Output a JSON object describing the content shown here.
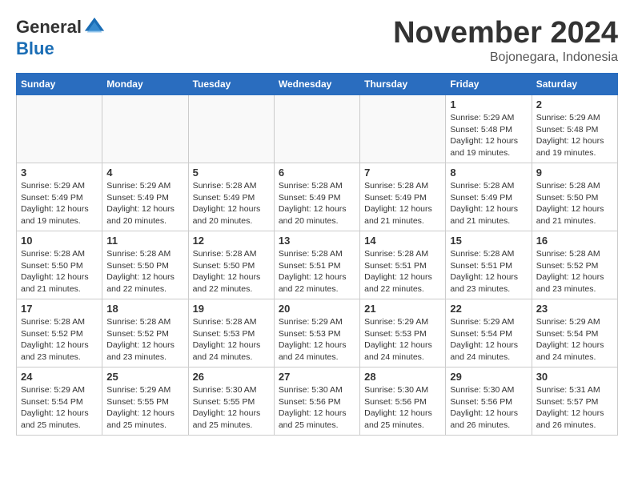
{
  "header": {
    "logo_general": "General",
    "logo_blue": "Blue",
    "month_title": "November 2024",
    "location": "Bojonegara, Indonesia"
  },
  "weekdays": [
    "Sunday",
    "Monday",
    "Tuesday",
    "Wednesday",
    "Thursday",
    "Friday",
    "Saturday"
  ],
  "weeks": [
    [
      {
        "day": "",
        "info": ""
      },
      {
        "day": "",
        "info": ""
      },
      {
        "day": "",
        "info": ""
      },
      {
        "day": "",
        "info": ""
      },
      {
        "day": "",
        "info": ""
      },
      {
        "day": "1",
        "info": "Sunrise: 5:29 AM\nSunset: 5:48 PM\nDaylight: 12 hours\nand 19 minutes."
      },
      {
        "day": "2",
        "info": "Sunrise: 5:29 AM\nSunset: 5:48 PM\nDaylight: 12 hours\nand 19 minutes."
      }
    ],
    [
      {
        "day": "3",
        "info": "Sunrise: 5:29 AM\nSunset: 5:49 PM\nDaylight: 12 hours\nand 19 minutes."
      },
      {
        "day": "4",
        "info": "Sunrise: 5:29 AM\nSunset: 5:49 PM\nDaylight: 12 hours\nand 20 minutes."
      },
      {
        "day": "5",
        "info": "Sunrise: 5:28 AM\nSunset: 5:49 PM\nDaylight: 12 hours\nand 20 minutes."
      },
      {
        "day": "6",
        "info": "Sunrise: 5:28 AM\nSunset: 5:49 PM\nDaylight: 12 hours\nand 20 minutes."
      },
      {
        "day": "7",
        "info": "Sunrise: 5:28 AM\nSunset: 5:49 PM\nDaylight: 12 hours\nand 21 minutes."
      },
      {
        "day": "8",
        "info": "Sunrise: 5:28 AM\nSunset: 5:49 PM\nDaylight: 12 hours\nand 21 minutes."
      },
      {
        "day": "9",
        "info": "Sunrise: 5:28 AM\nSunset: 5:50 PM\nDaylight: 12 hours\nand 21 minutes."
      }
    ],
    [
      {
        "day": "10",
        "info": "Sunrise: 5:28 AM\nSunset: 5:50 PM\nDaylight: 12 hours\nand 21 minutes."
      },
      {
        "day": "11",
        "info": "Sunrise: 5:28 AM\nSunset: 5:50 PM\nDaylight: 12 hours\nand 22 minutes."
      },
      {
        "day": "12",
        "info": "Sunrise: 5:28 AM\nSunset: 5:50 PM\nDaylight: 12 hours\nand 22 minutes."
      },
      {
        "day": "13",
        "info": "Sunrise: 5:28 AM\nSunset: 5:51 PM\nDaylight: 12 hours\nand 22 minutes."
      },
      {
        "day": "14",
        "info": "Sunrise: 5:28 AM\nSunset: 5:51 PM\nDaylight: 12 hours\nand 22 minutes."
      },
      {
        "day": "15",
        "info": "Sunrise: 5:28 AM\nSunset: 5:51 PM\nDaylight: 12 hours\nand 23 minutes."
      },
      {
        "day": "16",
        "info": "Sunrise: 5:28 AM\nSunset: 5:52 PM\nDaylight: 12 hours\nand 23 minutes."
      }
    ],
    [
      {
        "day": "17",
        "info": "Sunrise: 5:28 AM\nSunset: 5:52 PM\nDaylight: 12 hours\nand 23 minutes."
      },
      {
        "day": "18",
        "info": "Sunrise: 5:28 AM\nSunset: 5:52 PM\nDaylight: 12 hours\nand 23 minutes."
      },
      {
        "day": "19",
        "info": "Sunrise: 5:28 AM\nSunset: 5:53 PM\nDaylight: 12 hours\nand 24 minutes."
      },
      {
        "day": "20",
        "info": "Sunrise: 5:29 AM\nSunset: 5:53 PM\nDaylight: 12 hours\nand 24 minutes."
      },
      {
        "day": "21",
        "info": "Sunrise: 5:29 AM\nSunset: 5:53 PM\nDaylight: 12 hours\nand 24 minutes."
      },
      {
        "day": "22",
        "info": "Sunrise: 5:29 AM\nSunset: 5:54 PM\nDaylight: 12 hours\nand 24 minutes."
      },
      {
        "day": "23",
        "info": "Sunrise: 5:29 AM\nSunset: 5:54 PM\nDaylight: 12 hours\nand 24 minutes."
      }
    ],
    [
      {
        "day": "24",
        "info": "Sunrise: 5:29 AM\nSunset: 5:54 PM\nDaylight: 12 hours\nand 25 minutes."
      },
      {
        "day": "25",
        "info": "Sunrise: 5:29 AM\nSunset: 5:55 PM\nDaylight: 12 hours\nand 25 minutes."
      },
      {
        "day": "26",
        "info": "Sunrise: 5:30 AM\nSunset: 5:55 PM\nDaylight: 12 hours\nand 25 minutes."
      },
      {
        "day": "27",
        "info": "Sunrise: 5:30 AM\nSunset: 5:56 PM\nDaylight: 12 hours\nand 25 minutes."
      },
      {
        "day": "28",
        "info": "Sunrise: 5:30 AM\nSunset: 5:56 PM\nDaylight: 12 hours\nand 25 minutes."
      },
      {
        "day": "29",
        "info": "Sunrise: 5:30 AM\nSunset: 5:56 PM\nDaylight: 12 hours\nand 26 minutes."
      },
      {
        "day": "30",
        "info": "Sunrise: 5:31 AM\nSunset: 5:57 PM\nDaylight: 12 hours\nand 26 minutes."
      }
    ]
  ]
}
